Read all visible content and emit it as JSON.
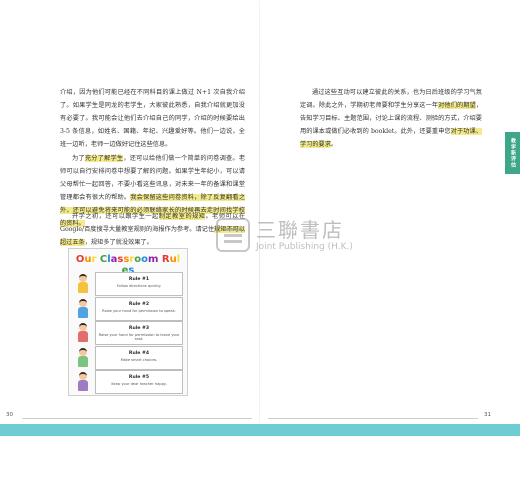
{
  "left_page": {
    "para1": [
      {
        "t": "介绍，因为他们可能已经在不同科目的课上做过 N+1 次自我介绍了。如果学生是同龙的老学生，大家彼此熟悉，自我介绍就更加没有必要了。我可能会让他们去介绍自己的同学，介绍的时候要给出 3-5 条信息，如姓名、国籍、年纪、兴趣爱好等。他们一边说，全班一边听，老师一边做好记住这些信息。",
        "h": false
      }
    ],
    "para2": [
      {
        "t": "为了",
        "h": false
      },
      {
        "t": "充分了解学生",
        "h": true
      },
      {
        "t": "，还可以给他们做一个简单的问卷调查。老师可以自行安排问卷中想要了解的问题。如果学生年纪小，可以请父母帮忙一起回答，不要小看这些讯息，对未来一年的备课和课堂管理都会有很大的帮助。",
        "h": false
      },
      {
        "t": "我会保留这些问卷资料，除了反复翻看之外，还可以避免将来可能的必须联络家长的时候再去走时间找学校的资料。",
        "h": true
      }
    ],
    "para3": [
      {
        "t": "开学之初，还可以跟学生一起",
        "h": false
      },
      {
        "t": "制定教室的规矩",
        "h": true
      },
      {
        "t": "。老师可以在 Google/百度搜寻大量教室规则的海报作为参考。请记住",
        "h": false
      },
      {
        "t": "规矩不可以超过五条",
        "h": true
      },
      {
        "t": "，规矩多了就没效果了。",
        "h": false
      }
    ]
  },
  "right_page": {
    "para1": [
      {
        "t": "通过这些互动可以建立彼此的关系，也为日后班级的学习气氛定调。除此之外，学期初老师要和学生分享这一年",
        "h": false
      },
      {
        "t": "对他们的期望",
        "h": true
      },
      {
        "t": "，告知学习目标、主题范围，讨论上课的流程、测验的方式，介绍要用的课本或做们必收到的 booklet。此外，还要重申您",
        "h": false
      },
      {
        "t": "对于功课、学习的要求",
        "h": true
      },
      {
        "t": "。",
        "h": false
      }
    ]
  },
  "poster": {
    "title_letters": [
      "O",
      "u",
      "r",
      " ",
      "C",
      "l",
      "a",
      "s",
      "s",
      "r",
      "o",
      "o",
      "m",
      " ",
      "R",
      "u",
      "l",
      "e",
      "s"
    ],
    "title_colors": [
      "#e53935",
      "#fb8c00",
      "#fdd835",
      "#ffffff",
      "#43a047",
      "#1e88e5",
      "#8e24aa",
      "#e53935",
      "#fb8c00",
      "#fdd835",
      "#43a047",
      "#1e88e5",
      "#8e24aa",
      "#ffffff",
      "#e53935",
      "#fb8c00",
      "#fdd835",
      "#43a047",
      "#1e88e5"
    ],
    "rules": [
      {
        "no": "Rule #1",
        "text": "Follow directions quickly.",
        "shirt": "#f6c23e"
      },
      {
        "no": "Rule #2",
        "text": "Raise your hand for permission to speak.",
        "shirt": "#4fa3e0"
      },
      {
        "no": "Rule #3",
        "text": "Raise your hand for permission to leave your seat.",
        "shirt": "#e36c6c"
      },
      {
        "no": "Rule #4",
        "text": "Make smart choices.",
        "shirt": "#7bc47f"
      },
      {
        "no": "Rule #5",
        "text": "Keep your dear teacher happy.",
        "shirt": "#9e7cc1"
      }
    ]
  },
  "side_tab": "教学新评估",
  "watermark": {
    "zh": "三聯書店",
    "en": "Joint Publishing (H.K.)"
  },
  "folios": {
    "left": "30",
    "right": "31"
  },
  "colors": {
    "highlight": "#f3ea8a",
    "band": "#6ecdd2",
    "tab": "#3ea68a"
  }
}
